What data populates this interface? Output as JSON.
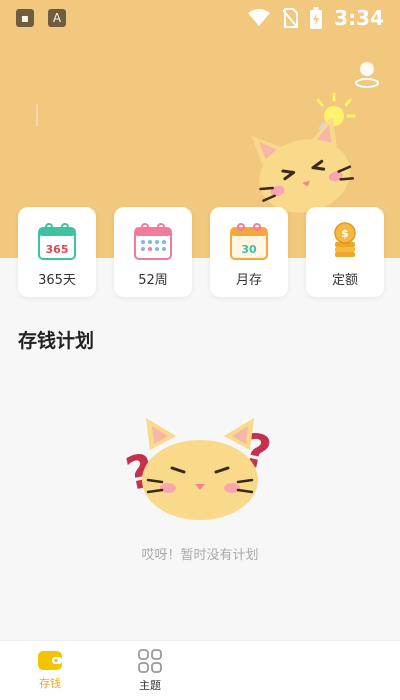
{
  "status_bar": {
    "time": "3:34",
    "icon_a": "A"
  },
  "header": {
    "bg_color": "#f2c77e"
  },
  "categories": [
    {
      "label": "365天",
      "calendar_text": "365",
      "accent": "#3fc2a0",
      "text_color": "#e0475a"
    },
    {
      "label": "52周",
      "calendar_text": "",
      "accent": "#f27a9a",
      "text_color": "#e0475a"
    },
    {
      "label": "月存",
      "calendar_text": "30",
      "accent": "#f5a640",
      "text_color": "#3bbfa6"
    },
    {
      "label": "定额",
      "calendar_text": "$",
      "accent": "#f5b840",
      "text_color": "#ffffff"
    }
  ],
  "main": {
    "section_title": "存钱计划",
    "empty_message": "哎呀！暂时没有计划"
  },
  "bottom_nav": {
    "items": [
      {
        "label": "存钱",
        "active": true
      },
      {
        "label": "主题",
        "active": false
      }
    ],
    "active_color": "#f5a623",
    "inactive_color": "#333333"
  }
}
